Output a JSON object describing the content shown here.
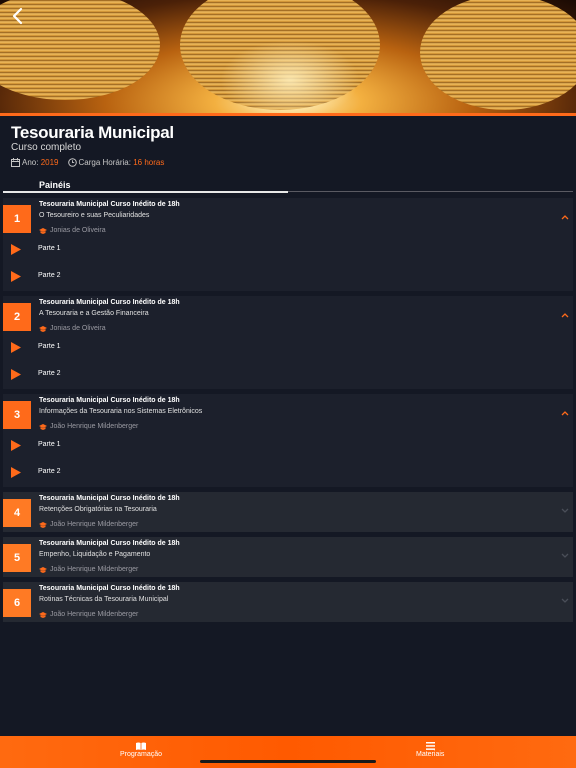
{
  "course": {
    "title": "Tesouraria Municipal",
    "subtitle": "Curso completo",
    "year_label": "Ano:",
    "year_value": "2019",
    "hours_label": "Carga Horária:",
    "hours_value": "16 horas"
  },
  "tabs": {
    "active": "Painéis"
  },
  "panels": [
    {
      "num": "1",
      "title": "Tesouraria Municipal Curso Inédito de 18h",
      "subtitle": "O Tesoureiro e suas Peculiaridades",
      "author": "Jonias de Oliveira",
      "expanded": true,
      "parts": [
        "Parte 1",
        "Parte 2"
      ]
    },
    {
      "num": "2",
      "title": "Tesouraria Municipal Curso Inédito de 18h",
      "subtitle": "A Tesouraria e a Gestão Financeira",
      "author": "Jonias de Oliveira",
      "expanded": true,
      "parts": [
        "Parte 1",
        "Parte 2"
      ]
    },
    {
      "num": "3",
      "title": "Tesouraria Municipal Curso Inédito de 18h",
      "subtitle": "Informações da Tesouraria nos Sistemas Eletrônicos",
      "author": "João Henrique Mildenberger",
      "expanded": true,
      "parts": [
        "Parte 1",
        "Parte 2"
      ]
    },
    {
      "num": "4",
      "title": "Tesouraria Municipal Curso Inédito de 18h",
      "subtitle": "Retenções Obrigatórias na Tesouraria",
      "author": "João Henrique Mildenberger",
      "expanded": false
    },
    {
      "num": "5",
      "title": "Tesouraria Municipal Curso Inédito de 18h",
      "subtitle": "Empenho, Liquidação e Pagamento",
      "author": "João Henrique Mildenberger",
      "expanded": false
    },
    {
      "num": "6",
      "title": "Tesouraria Municipal Curso Inédito de 18h",
      "subtitle": "Rotinas Técnicas da Tesouraria Municipal",
      "author": "João Henrique Mildenberger",
      "expanded": false
    }
  ],
  "bottom_nav": {
    "left_label": "Programação",
    "right_label": "Materiais"
  },
  "colors": {
    "accent": "#ff6a1a",
    "background": "#141824",
    "panel": "#1c202c",
    "panel_collapsed": "#252932"
  },
  "icons": {
    "back": "chevron-left-icon",
    "calendar": "calendar-icon",
    "clock": "clock-icon",
    "author": "graduation-cap-icon",
    "play": "play-icon",
    "expand": "chevron-up-icon",
    "collapse": "chevron-down-icon",
    "book": "book-icon",
    "menu": "menu-icon"
  }
}
